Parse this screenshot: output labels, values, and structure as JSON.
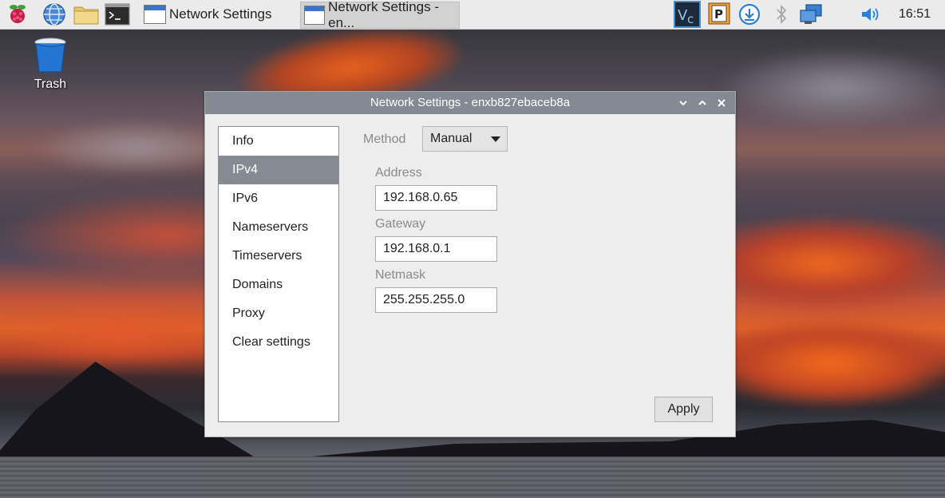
{
  "taskbar": {
    "launchers": [
      {
        "name": "raspberry-menu-icon"
      },
      {
        "name": "web-browser-icon"
      },
      {
        "name": "file-manager-icon"
      },
      {
        "name": "terminal-icon"
      }
    ],
    "tasks": [
      {
        "label": "Network Settings",
        "active": false
      },
      {
        "label": "Network Settings - en...",
        "active": true
      }
    ],
    "tray": [
      "vnc-icon",
      "parcel-icon",
      "download-icon",
      "bluetooth-icon",
      "network-icon",
      "volume-icon"
    ],
    "clock": "16:51"
  },
  "desktop": {
    "trash_label": "Trash"
  },
  "window": {
    "title": "Network Settings - enxb827ebaceb8a",
    "sidebar": [
      {
        "label": "Info",
        "selected": false
      },
      {
        "label": "IPv4",
        "selected": true
      },
      {
        "label": "IPv6",
        "selected": false
      },
      {
        "label": "Nameservers",
        "selected": false
      },
      {
        "label": "Timeservers",
        "selected": false
      },
      {
        "label": "Domains",
        "selected": false
      },
      {
        "label": "Proxy",
        "selected": false
      },
      {
        "label": "Clear settings",
        "selected": false
      }
    ],
    "method_label": "Method",
    "method_value": "Manual",
    "address_label": "Address",
    "address_value": "192.168.0.65",
    "gateway_label": "Gateway",
    "gateway_value": "192.168.0.1",
    "netmask_label": "Netmask",
    "netmask_value": "255.255.255.0",
    "apply_label": "Apply"
  },
  "colors": {
    "titlebar": "#848a93",
    "selected_item": "#868a92",
    "taskbar": "#ebebeb"
  }
}
